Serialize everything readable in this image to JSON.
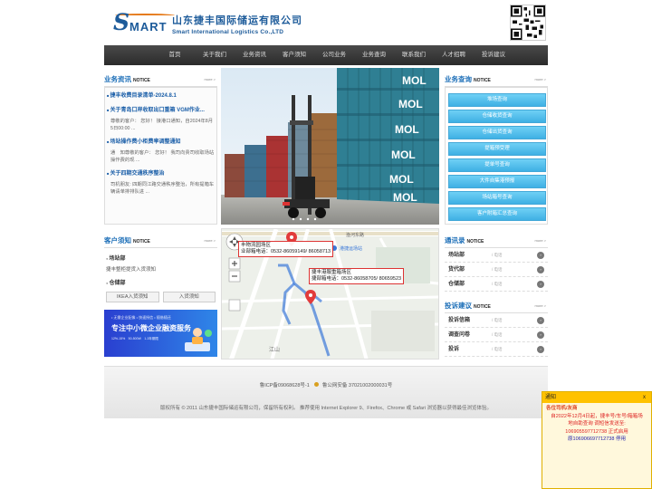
{
  "header": {
    "logo_text_s": "S",
    "logo_text_mart": "MART",
    "company_cn": "山东捷丰国际储运有限公司",
    "company_en": "Smart International Logistics Co.,LTD"
  },
  "nav": [
    "首页",
    "关于我们",
    "业务资讯",
    "客户须知",
    "公司业务",
    "业务查询",
    "联系我们",
    "人才招聘",
    "投诉建议"
  ],
  "news": {
    "title": "业务资讯",
    "notice": "NOTICE",
    "more": "more >",
    "items": [
      {
        "title": "捷丰收费目录清单-2024.8.1",
        "body": ""
      },
      {
        "title": "关于青岛口岸收取出口重箱 VGM作业...",
        "body": "尊敬的客户： 您好！ 接港口通知，自2024年8月5日00:00 ..."
      },
      {
        "title": "场站操作费小柜费率调整通知",
        "body": "通　知尊敬的客户： 您好！ 我司向贵司收取场站操作费的现 ..."
      },
      {
        "title": "关于四期交通秩序整治",
        "body": "司机朋友: 四期同江路交通秩序整治，所有提箱车辆请单排排队进 ..."
      }
    ]
  },
  "banner": {
    "brand": "MOL"
  },
  "query": {
    "title": "业务查询",
    "notice": "NOTICE",
    "more": "more >",
    "buttons": [
      "堆场查询",
      "仓储收货查询",
      "仓储出货查询",
      "提箱预受理",
      "提单号查询",
      "大件自集港预报",
      "场站箱号查询",
      "客户附箱汇总查询"
    ]
  },
  "guide": {
    "title": "客户须知",
    "notice": "NOTICE",
    "more": "more >",
    "item1": "场站部",
    "item1_text": "捷丰整柜提货入货须知",
    "item2": "仓储部",
    "btn1": "IKEA入货须知",
    "btn2": "入货须知",
    "ad": {
      "line1": "• 无需企业配像 • 快速授信 • 随借随还",
      "line2": "专注中小微企业融资服务",
      "line3": "12%-15%　50-500W　1-3年期限"
    }
  },
  "map": {
    "label1_line1": "丰物流园场区",
    "label1_line2": "业部箱电话：0532-86059149/ 86058713",
    "label2_line1": "捷丰港服重箱场区",
    "label2_line2": "捷部箱电话：0532-86058705/ 80659523",
    "road1": "渔河东路",
    "road2": "港捷运场站",
    "road3": "江山"
  },
  "contacts": {
    "title": "通讯录",
    "notice": "NOTICE",
    "more": "more >",
    "rows": [
      {
        "name": "场站部",
        "tel": "/ 电话"
      },
      {
        "name": "货代部",
        "tel": "/ 电话"
      },
      {
        "name": "仓储部",
        "tel": "/ 电话"
      }
    ]
  },
  "complaints": {
    "title": "投诉建议",
    "notice": "NOTICE",
    "more": "more >",
    "rows": [
      {
        "name": "投诉信箱",
        "tel": "/ 电话"
      },
      {
        "name": "调查问卷",
        "tel": "/ 电话"
      },
      {
        "name": "投诉",
        "tel": "/ 电话"
      }
    ]
  },
  "footer": {
    "icp": "鲁ICP备09068628号-1",
    "police": "鲁公网安备 37021002000031号",
    "copyright": "版权所有 © 2011 山东捷丰国际储运有限公司，保留所有权利。 推荐使用 Internet Explorer 9、Firefox、Chrome 或 Safari 浏览器以获得最佳浏览体验。"
  },
  "popup": {
    "title": "通知",
    "close": "x",
    "line1": "各位司机/友商",
    "line2": "自2022年12月4日起，捷丰号/车号/箱箱场",
    "line3": "地自助查询 调短信发送至:",
    "line4": "106905597712738 正式启用",
    "line5": "原106906697712738 停用"
  },
  "colors": {
    "primary": "#1d6fb8",
    "nav_bg": "#3a3a3a",
    "query_btn": "#4fbde9",
    "popup_bar": "#ffc200"
  }
}
